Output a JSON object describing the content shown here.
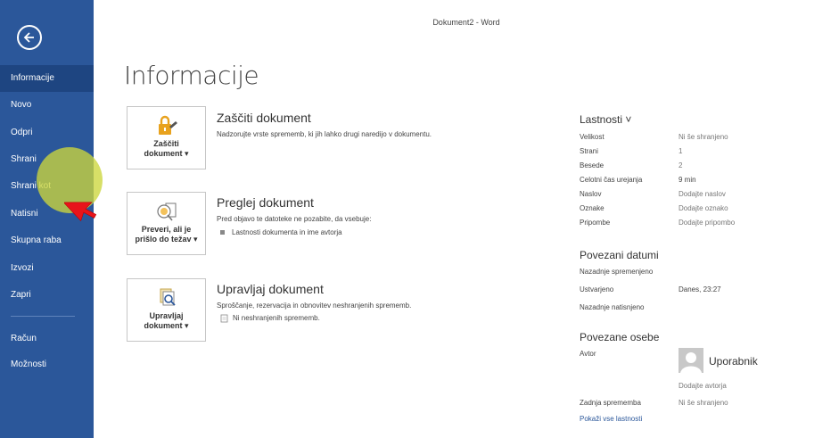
{
  "window": {
    "title": "Dokument2 - Word"
  },
  "sidebar": {
    "items": [
      {
        "label": "Informacije"
      },
      {
        "label": "Novo"
      },
      {
        "label": "Odpri"
      },
      {
        "label": "Shrani"
      },
      {
        "label": "Shrani kot"
      },
      {
        "label": "Natisni"
      },
      {
        "label": "Skupna raba"
      },
      {
        "label": "Izvozi"
      },
      {
        "label": "Zapri"
      },
      {
        "label": "Račun"
      },
      {
        "label": "Možnosti"
      }
    ],
    "accent": "#2b579a",
    "active_bg": "#1e4581"
  },
  "page": {
    "title": "Informacije"
  },
  "sections": [
    {
      "button_line1": "Zaščiti",
      "button_line2": "dokument ▾",
      "icon": "lock-icon",
      "title": "Zaščiti dokument",
      "desc": "Nadzorujte vrste sprememb, ki jih lahko drugi naredijo v dokumentu."
    },
    {
      "button_line1": "Preveri, ali je",
      "button_line2": "prišlo do težav ▾",
      "icon": "inspect-icon",
      "title": "Preglej dokument",
      "desc": "Pred objavo te datoteke ne pozabite, da vsebuje:",
      "bullet": "Lastnosti dokumenta in ime avtorja"
    },
    {
      "button_line1": "Upravljaj",
      "button_line2": "dokument ▾",
      "icon": "manage-document-icon",
      "title": "Upravljaj dokument",
      "desc": "Sproščanje, rezervacija in obnovitev neshranjenih sprememb.",
      "bullet": "Ni neshranjenih sprememb."
    }
  ],
  "properties": {
    "header": "Lastnosti ˅",
    "rows": [
      {
        "label": "Velikost",
        "value": "Ni še shranjeno"
      },
      {
        "label": "Strani",
        "value": "1"
      },
      {
        "label": "Besede",
        "value": "2"
      },
      {
        "label": "Celotni čas urejanja",
        "value": "9 min"
      },
      {
        "label": "Naslov",
        "value": "Dodajte naslov"
      },
      {
        "label": "Oznake",
        "value": "Dodajte oznako"
      },
      {
        "label": "Pripombe",
        "value": "Dodajte pripombo"
      }
    ]
  },
  "dates": {
    "header": "Povezani datumi",
    "rows": [
      {
        "label": "Nazadnje spremenjeno",
        "value": ""
      },
      {
        "label": "Ustvarjeno",
        "value": "Danes, 23:27"
      },
      {
        "label": "Nazadnje natisnjeno",
        "value": ""
      }
    ]
  },
  "people": {
    "header": "Povezane osebe",
    "author_label": "Avtor",
    "author_name": "Uporabnik",
    "add_author": "Dodajte avtorja",
    "last_modified_label": "Zadnja sprememba",
    "last_modified_value": "Ni še shranjeno"
  },
  "show_all": "Pokaži vse lastnosti"
}
